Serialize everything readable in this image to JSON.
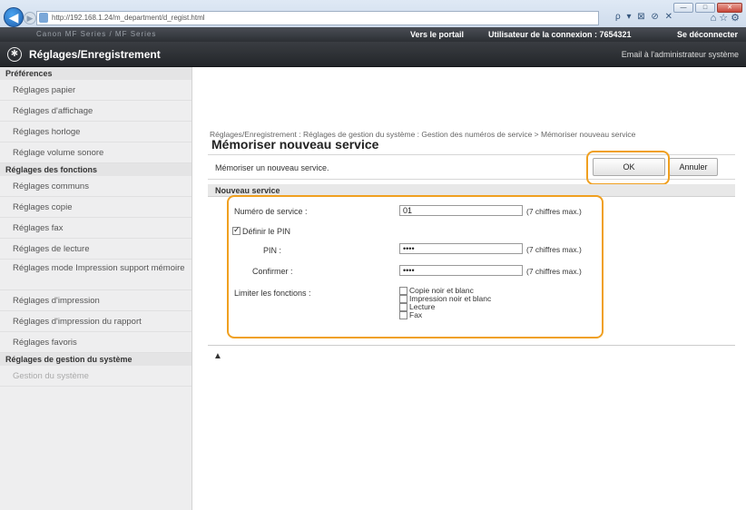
{
  "browser": {
    "url": "http://192.168.1.24/m_department/d_regist.html",
    "tools": "ρ ▾ ⊠ ⊘ ✕",
    "window_buttons": {
      "minimize": "—",
      "maximize": "□",
      "close": "✕"
    }
  },
  "topbar": {
    "device": "Canon MF Series / MF Series",
    "portal_link": "Vers le portail",
    "user_info": "Utilisateur de la connexion : 7654321",
    "logout_link": "Se déconnecter"
  },
  "header": {
    "title": "Réglages/Enregistrement",
    "mail_link": "Email à l'administrateur système"
  },
  "sidebar": {
    "sections": [
      {
        "header": "Préférences",
        "items": [
          "Réglages papier",
          "Réglages d'affichage",
          "Réglages horloge",
          "Réglage volume sonore"
        ]
      },
      {
        "header": "Réglages des fonctions",
        "items": [
          "Réglages communs",
          "Réglages copie",
          "Réglages fax",
          "Réglages de lecture",
          "Réglages mode Impression support mémoire",
          "Réglages d'impression",
          "Réglages d'impression du rapport",
          "Réglages favoris"
        ]
      },
      {
        "header": "Réglages de gestion du système",
        "items": [
          "Gestion du système"
        ]
      }
    ]
  },
  "main": {
    "breadcrumb": "Réglages/Enregistrement : Réglages de gestion du système : Gestion des numéros de service > Mémoriser nouveau service",
    "title": "Mémoriser nouveau service",
    "description": "Mémoriser un nouveau service.",
    "ok_label": "OK",
    "cancel_label": "Annuler",
    "section_title": "Nouveau service",
    "form": {
      "service_number_label": "Numéro de service :",
      "service_number_value": "01",
      "hint": "(7 chiffres max.)",
      "define_pin_label": "Définir le PIN",
      "define_pin_checked": true,
      "pin_label": "PIN :",
      "pin_value": "••••",
      "confirm_label": "Confirmer :",
      "confirm_value": "••••",
      "limit_label": "Limiter les fonctions :",
      "functions": [
        "Copie noir et blanc",
        "Impression noir et blanc",
        "Lecture",
        "Fax"
      ]
    },
    "top_link": "▲"
  },
  "colors": {
    "highlight": "#f0a020",
    "header_dark": "#2c2f34",
    "sidebar_bg": "#eeeeef"
  }
}
